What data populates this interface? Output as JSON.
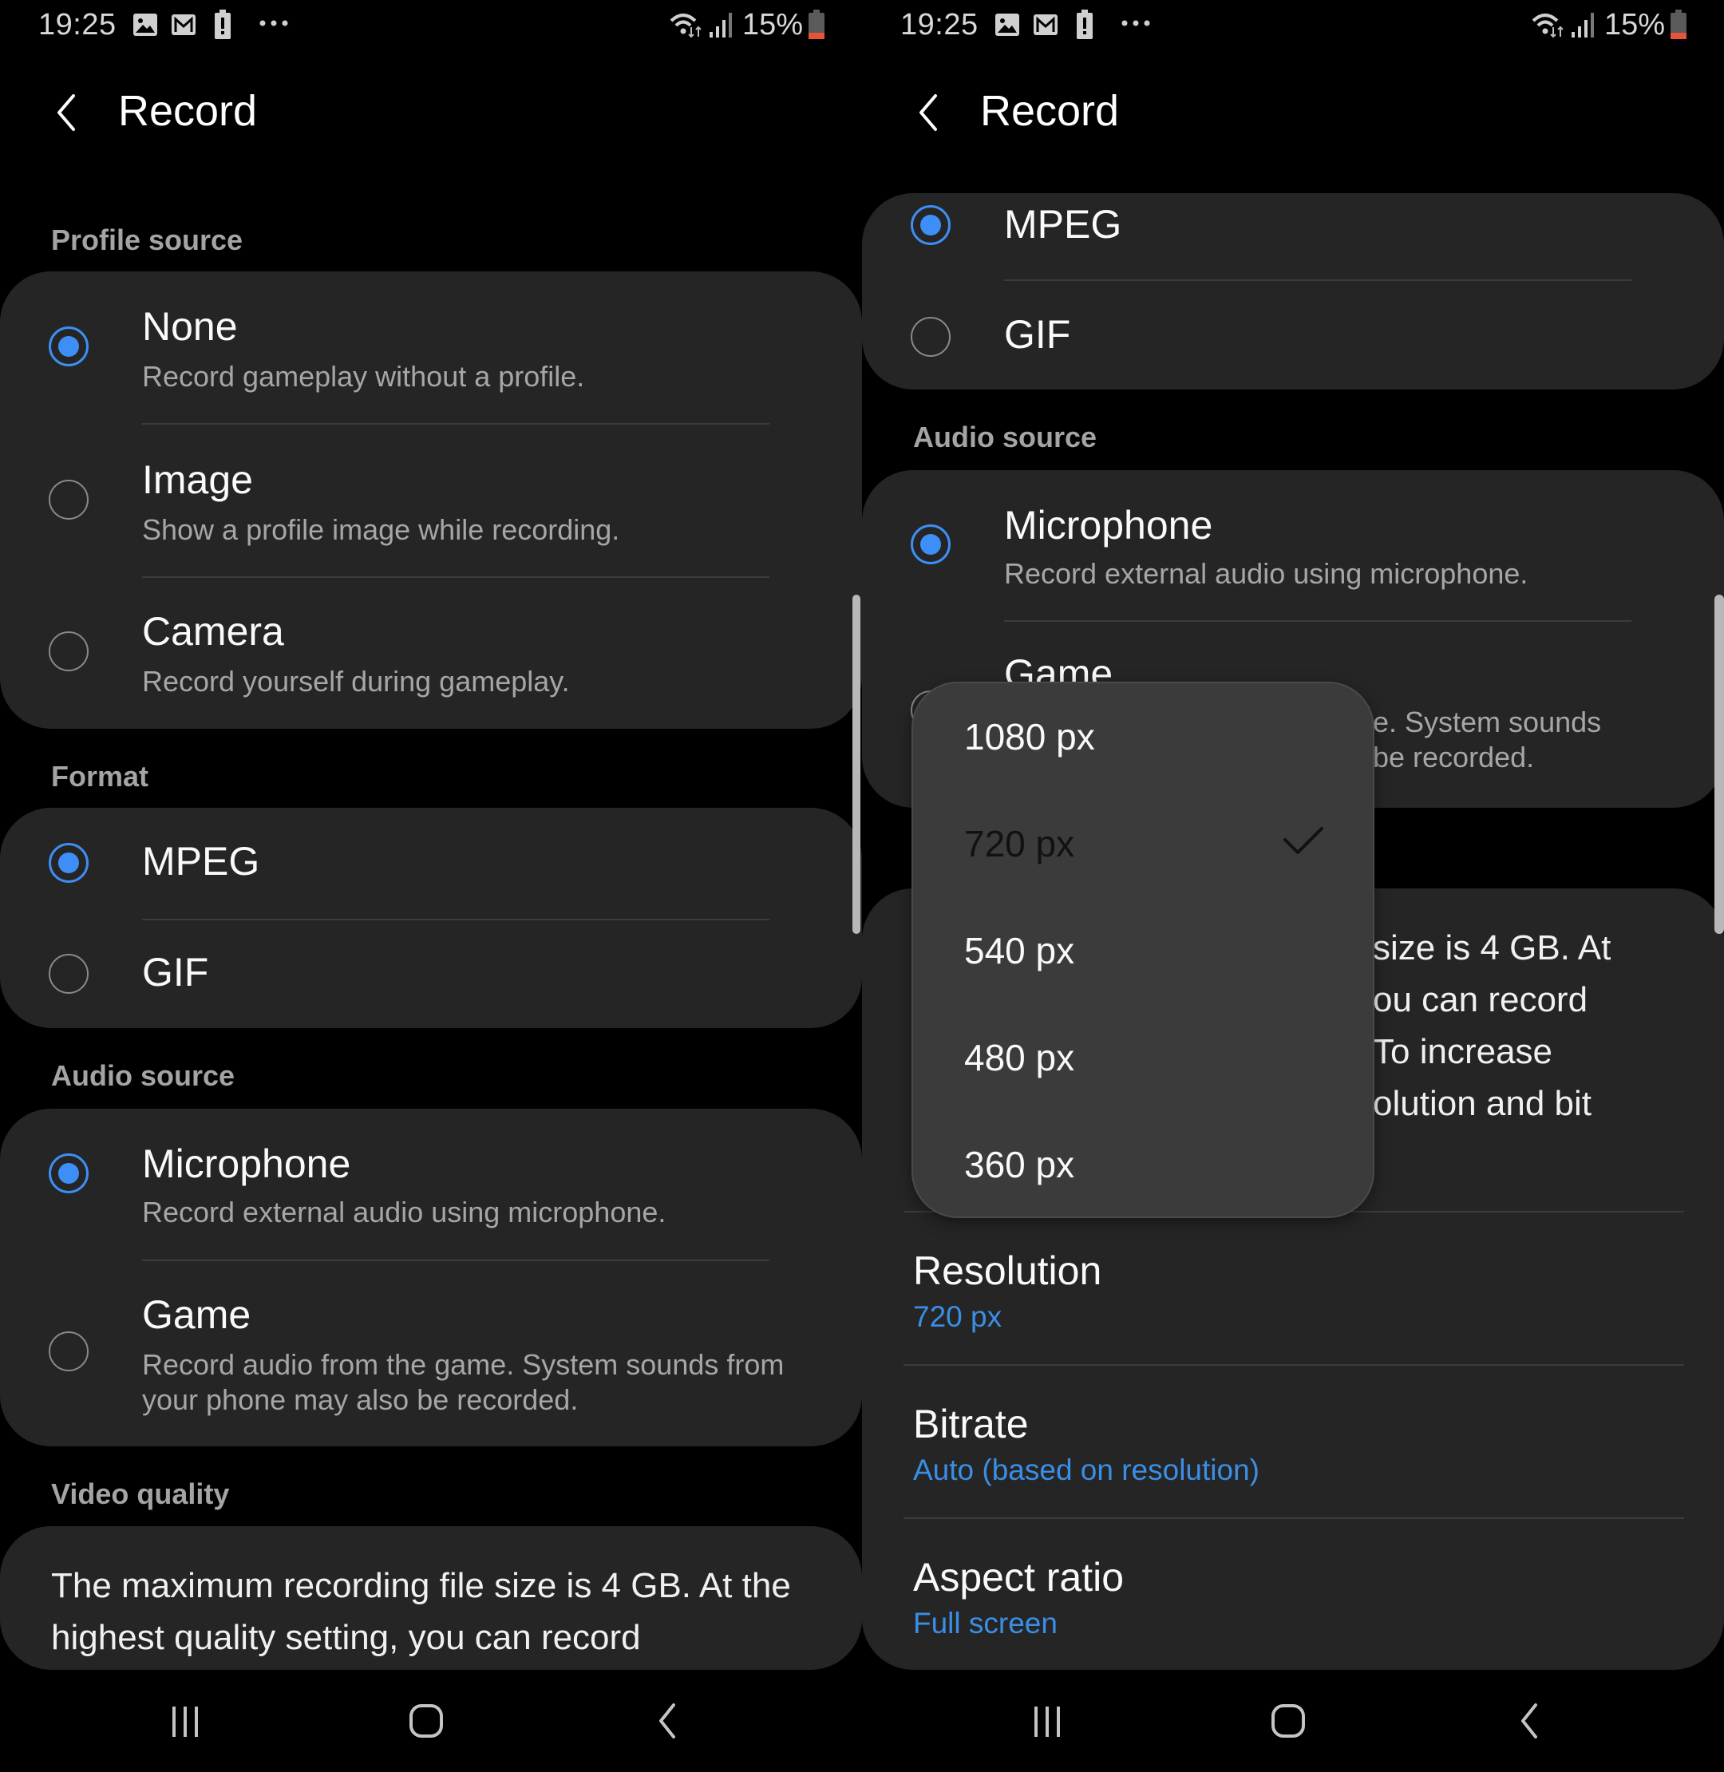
{
  "status_bar": {
    "time": "19:25",
    "notification_icons": [
      "gallery-icon",
      "gmail-icon",
      "battery-alert-icon",
      "more-notifications-icon"
    ],
    "battery_percent": "15%",
    "battery_level": 0.15,
    "colors": {
      "battery_low": "#e5533b"
    }
  },
  "header": {
    "title": "Record",
    "back_icon": "chevron-left-icon"
  },
  "colors": {
    "accent": "#3e8ef7",
    "link_value": "#3a8ee6",
    "card_bg": "#252525",
    "dropdown_bg": "#3b3b3b"
  },
  "left_screen": {
    "sections": {
      "profile_source": {
        "label": "Profile source",
        "options": [
          {
            "title": "None",
            "description": "Record gameplay without a profile.",
            "selected": true
          },
          {
            "title": "Image",
            "description": "Show a profile image while recording.",
            "selected": false
          },
          {
            "title": "Camera",
            "description": "Record yourself during gameplay.",
            "selected": false
          }
        ]
      },
      "format": {
        "label": "Format",
        "options": [
          {
            "title": "MPEG",
            "selected": true
          },
          {
            "title": "GIF",
            "selected": false
          }
        ]
      },
      "audio_source": {
        "label": "Audio source",
        "options": [
          {
            "title": "Microphone",
            "description": "Record external audio using microphone.",
            "selected": true
          },
          {
            "title": "Game",
            "description": "Record audio from the game. System sounds from your phone may also be recorded.",
            "selected": false
          }
        ]
      },
      "video_quality": {
        "label": "Video quality",
        "text": "The maximum recording file size is 4 GB. At the highest quality setting, you can record"
      }
    }
  },
  "right_screen": {
    "format": {
      "options": [
        {
          "title": "MPEG",
          "selected": true
        },
        {
          "title": "GIF",
          "selected": false
        }
      ]
    },
    "audio_source": {
      "label": "Audio source",
      "options": [
        {
          "title": "Microphone",
          "description": "Record external audio using microphone.",
          "selected": true
        },
        {
          "title": "Game",
          "description_visible_1": "e. System sounds",
          "description_visible_2": "be recorded.",
          "selected": false
        }
      ]
    },
    "video_quality": {
      "text_fragments": [
        "size is 4 GB. At",
        "ou can record",
        "To increase",
        "olution and bit"
      ],
      "settings": [
        {
          "title": "Resolution",
          "value": "720 px"
        },
        {
          "title": "Bitrate",
          "value": "Auto (based on resolution)"
        },
        {
          "title": "Aspect ratio",
          "value": "Full screen"
        }
      ]
    },
    "resolution_dropdown": {
      "options": [
        "1080 px",
        "720 px",
        "540 px",
        "480 px",
        "360 px"
      ],
      "selected": "720 px",
      "selected_index": 1
    }
  },
  "nav_bar": {
    "recents_icon": "recents-icon",
    "home_icon": "home-icon",
    "back_icon": "back-icon"
  }
}
